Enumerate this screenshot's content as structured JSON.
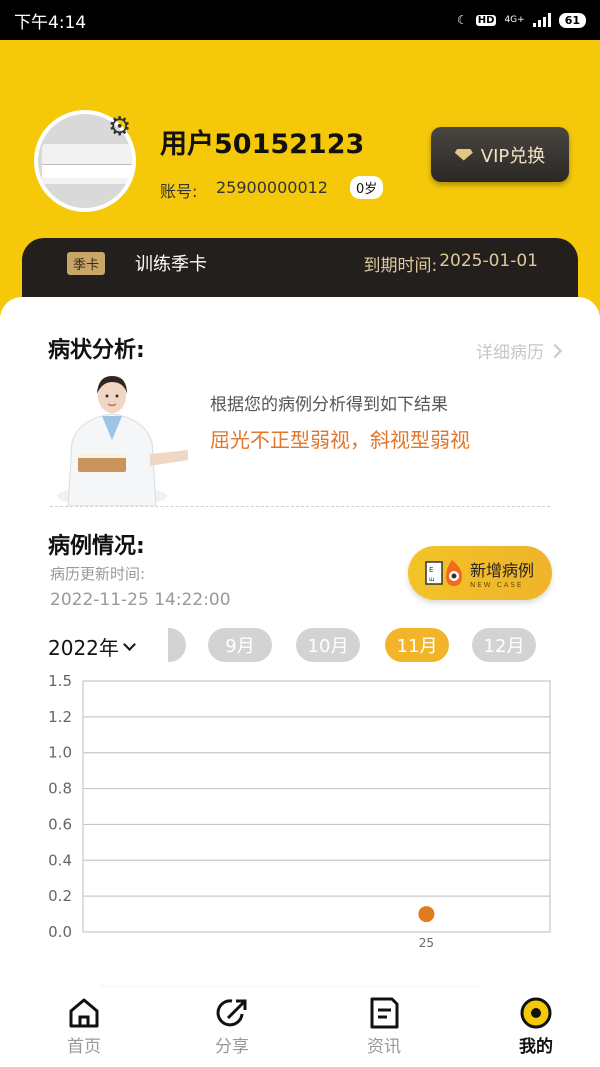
{
  "status_bar": {
    "time": "下午4:14",
    "hd": "HD",
    "network": "4G+",
    "battery": "61"
  },
  "profile": {
    "username": "用户50152123",
    "account_label": "账号:",
    "account_number": "25900000012",
    "age": "0岁",
    "vip_button": "VIP兑换"
  },
  "membership": {
    "badge": "季卡",
    "plan": "训练季卡",
    "expiry_label": "到期时间:",
    "expiry_date": "2025-01-01"
  },
  "analysis": {
    "title": "病状分析:",
    "detail_link": "详细病历",
    "description": "根据您的病例分析得到如下结果",
    "result": "屈光不正型弱视，斜视型弱视"
  },
  "cases": {
    "title": "病例情况:",
    "update_label": "病历更新时间:",
    "update_time": "2022-11-25 14:22:00",
    "new_case_label": "新增病例",
    "new_case_sub": "NEW CASE"
  },
  "calendar": {
    "year": "2022年",
    "months": [
      {
        "label": "9月",
        "active": false
      },
      {
        "label": "10月",
        "active": false
      },
      {
        "label": "11月",
        "active": true
      },
      {
        "label": "12月",
        "active": false
      }
    ]
  },
  "chart_data": {
    "type": "scatter",
    "title": "",
    "xlabel": "",
    "ylabel": "",
    "x_ticks": [
      "25"
    ],
    "y_ticks": [
      "0.0",
      "0.2",
      "0.4",
      "0.6",
      "0.8",
      "1.0",
      "1.2",
      "1.5"
    ],
    "ylim": [
      0,
      1.5
    ],
    "grid": true,
    "series": [
      {
        "points": [
          {
            "x": "25",
            "y": 0.1
          }
        ]
      }
    ],
    "colors": {
      "point": "#e07b20",
      "grid": "#c8c8c8"
    }
  },
  "tabs": [
    {
      "label": "首页",
      "icon": "home-icon",
      "active": false
    },
    {
      "label": "分享",
      "icon": "share-icon",
      "active": false
    },
    {
      "label": "资讯",
      "icon": "news-icon",
      "active": false
    },
    {
      "label": "我的",
      "icon": "profile-icon",
      "active": true
    }
  ],
  "colors": {
    "brand_yellow": "#f5c90a",
    "accent_orange": "#e2762a",
    "dark": "#231f1c"
  }
}
